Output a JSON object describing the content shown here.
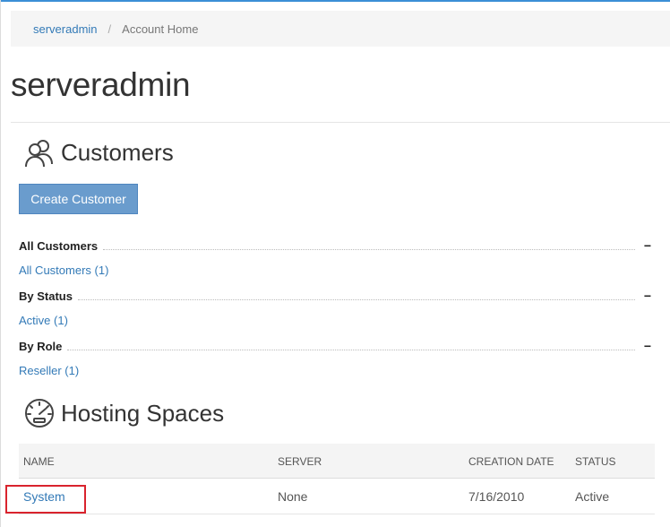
{
  "breadcrumb": {
    "home_link": "serveradmin",
    "separator": "/",
    "current": "Account Home"
  },
  "page_title": "serveradmin",
  "customers": {
    "heading": "Customers",
    "icon": "users-icon",
    "create_button": "Create Customer",
    "groups": [
      {
        "label": "All Customers",
        "collapse": "−",
        "link": "All Customers (1)"
      },
      {
        "label": "By Status",
        "collapse": "−",
        "link": "Active (1)"
      },
      {
        "label": "By Role",
        "collapse": "−",
        "link": "Reseller (1)"
      }
    ]
  },
  "hosting_spaces": {
    "heading": "Hosting Spaces",
    "icon": "dashboard-gauge-icon",
    "columns": [
      "NAME",
      "SERVER",
      "CREATION DATE",
      "STATUS"
    ],
    "rows": [
      {
        "name": "System",
        "server": "None",
        "creation_date": "7/16/2010",
        "status": "Active"
      }
    ]
  },
  "colors": {
    "accent": "#337ab7",
    "button": "#6a9ccd",
    "highlight": "#d9232d"
  }
}
